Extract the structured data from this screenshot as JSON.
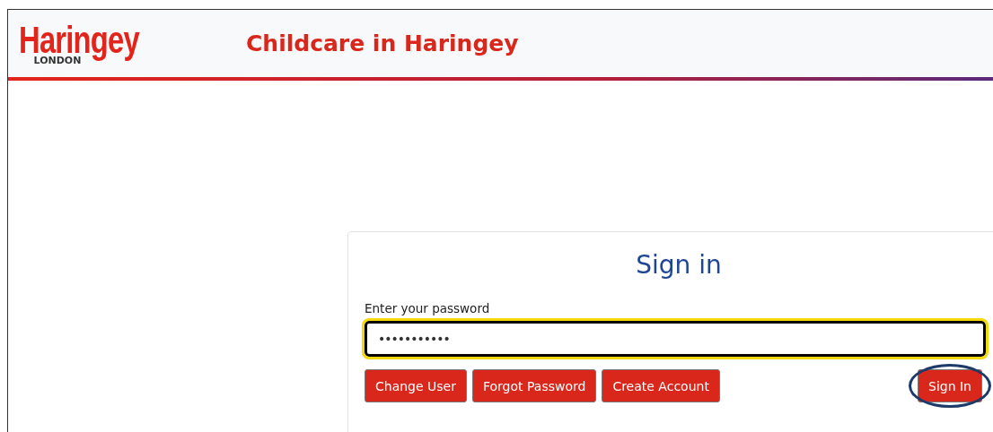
{
  "header": {
    "logo": {
      "name": "Haringey",
      "subtitle": "LONDON"
    },
    "title": "Childcare in Haringey"
  },
  "sign_in": {
    "title": "Sign in",
    "password_label": "Enter your password",
    "password_value": "•••••••••••",
    "password_focused": true,
    "buttons": [
      {
        "label": "Change User",
        "highlighted": false
      },
      {
        "label": "Forgot Password",
        "highlighted": false
      },
      {
        "label": "Create Account",
        "highlighted": false
      },
      {
        "label": "Sign In",
        "highlighted": true
      }
    ]
  }
}
